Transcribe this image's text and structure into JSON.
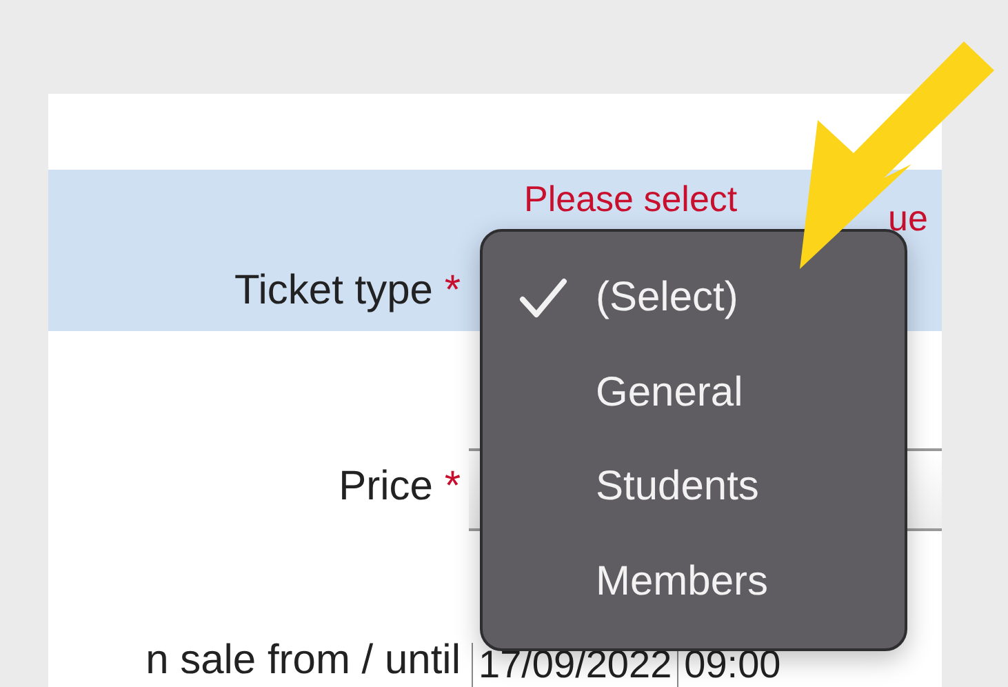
{
  "form": {
    "rows": [
      {
        "kind": "select",
        "label": "Ticket type",
        "required_mark": "*",
        "highlighted": true,
        "error_parts": [
          "Please select",
          "ue"
        ]
      },
      {
        "kind": "field",
        "label": "Price",
        "required_mark": "*",
        "highlighted": false
      },
      {
        "kind": "dates",
        "label": "n sale from / until",
        "highlighted": false,
        "values": [
          "17/09/2022",
          "09:00"
        ]
      }
    ]
  },
  "dropdown_menu": {
    "items": [
      {
        "label": "(Select)",
        "selected": true
      },
      {
        "label": "General",
        "selected": false
      },
      {
        "label": "Students",
        "selected": false
      },
      {
        "label": "Members",
        "selected": false
      }
    ]
  }
}
